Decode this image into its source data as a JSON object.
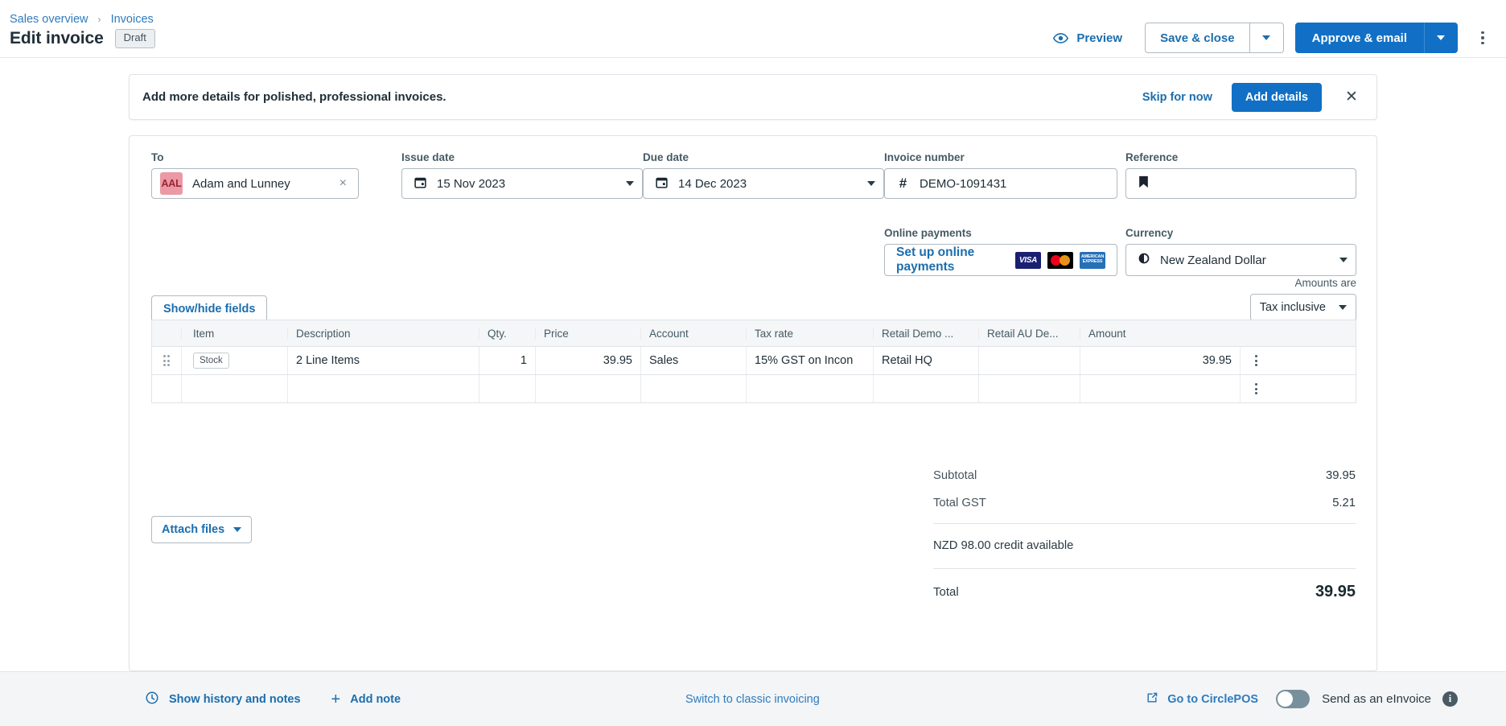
{
  "header": {
    "breadcrumb": {
      "sales_overview": "Sales overview",
      "separator": "›",
      "invoices": "Invoices"
    },
    "title": "Edit invoice",
    "status": "Draft",
    "preview_label": "Preview",
    "save_close_label": "Save & close",
    "approve_email_label": "Approve & email"
  },
  "banner": {
    "message": "Add more details for polished, professional invoices.",
    "skip_label": "Skip for now",
    "add_details_label": "Add details",
    "close_label": "✕"
  },
  "form": {
    "to": {
      "label": "To",
      "initials": "AAL",
      "value": "Adam and Lunney",
      "clear": "×"
    },
    "issue_date": {
      "label": "Issue date",
      "value": "15 Nov 2023"
    },
    "due_date": {
      "label": "Due date",
      "value": "14 Dec 2023"
    },
    "invoice_number": {
      "label": "Invoice number",
      "value": "DEMO-1091431"
    },
    "reference": {
      "label": "Reference",
      "value": ""
    },
    "online_payments": {
      "label": "Online payments",
      "cta": "Set up online payments",
      "cards": [
        "VISA",
        "mastercard",
        "AMERICAN EXPRESS"
      ]
    },
    "currency": {
      "label": "Currency",
      "value": "New Zealand Dollar"
    },
    "show_hide_fields": "Show/hide fields",
    "amounts_are": {
      "label": "Amounts are",
      "value": "Tax inclusive"
    }
  },
  "grid": {
    "columns": [
      "",
      "Item",
      "Description",
      "Qty.",
      "Price",
      "Account",
      "Tax rate",
      "Retail Demo ...",
      "Retail AU De...",
      "Amount",
      ""
    ],
    "rows": [
      {
        "item_chip": "Stock",
        "description": "2 Line Items",
        "qty": "1",
        "price": "39.95",
        "account": "Sales",
        "tax_rate": "15% GST on Incon",
        "retail_demo": "Retail HQ",
        "retail_au": "",
        "amount": "39.95"
      },
      {
        "item_chip": "",
        "description": "",
        "qty": "",
        "price": "",
        "account": "",
        "tax_rate": "",
        "retail_demo": "",
        "retail_au": "",
        "amount": ""
      }
    ]
  },
  "totals": {
    "subtotal_label": "Subtotal",
    "subtotal_value": "39.95",
    "gst_label": "Total GST",
    "gst_value": "5.21",
    "credit_note": "NZD 98.00 credit available",
    "total_label": "Total",
    "total_value": "39.95"
  },
  "attach": {
    "label": "Attach files"
  },
  "footer": {
    "show_history": "Show history and notes",
    "add_note": "Add note",
    "switch_classic": "Switch to classic invoicing",
    "go_to_circlepos": "Go to CirclePOS",
    "einvoice_label": "Send as an eInvoice",
    "einvoice_enabled": false,
    "info": "i"
  },
  "colors": {
    "accent_blue": "#1170c5",
    "link_blue": "#1c6ead",
    "avatar_bg": "#eb9aa5",
    "avatar_fg": "#9b2335",
    "banner_border": "#dfe3e8",
    "footer_bg": "#f3f5f7"
  }
}
